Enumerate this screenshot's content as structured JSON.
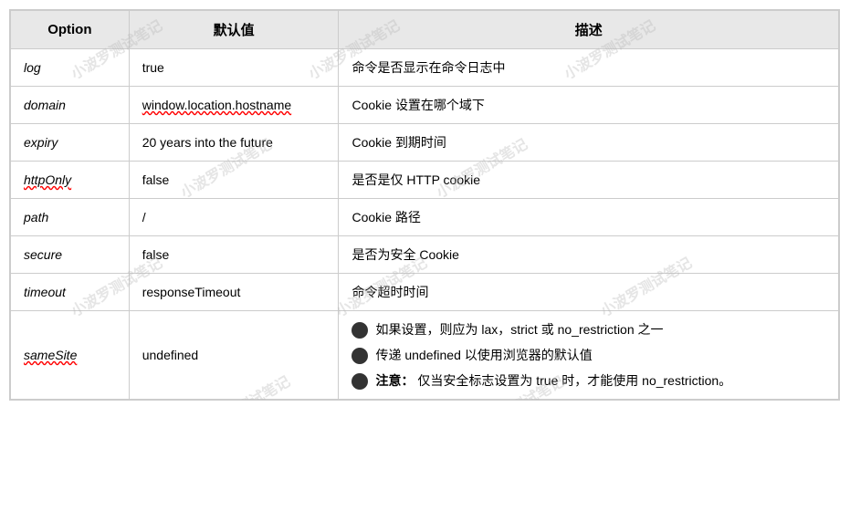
{
  "table": {
    "headers": {
      "option": "Option",
      "default": "默认值",
      "description": "描述"
    },
    "rows": [
      {
        "option": "log",
        "option_underline": false,
        "default": "true",
        "default_underline": false,
        "description_text": "命令是否显示在命令日志中",
        "description_type": "text"
      },
      {
        "option": "domain",
        "option_underline": false,
        "default": "window.location.hostname",
        "default_underline": true,
        "description_text": "Cookie 设置在哪个域下",
        "description_type": "text"
      },
      {
        "option": "expiry",
        "option_underline": false,
        "default": "20 years into the future",
        "default_underline": false,
        "description_text": "Cookie 到期时间",
        "description_type": "text"
      },
      {
        "option": "httpOnly",
        "option_underline": true,
        "default": "false",
        "default_underline": false,
        "description_text": "是否是仅 HTTP cookie",
        "description_type": "text"
      },
      {
        "option": "path",
        "option_underline": false,
        "default": "/",
        "default_underline": false,
        "description_text": "Cookie 路径",
        "description_type": "text"
      },
      {
        "option": "secure",
        "option_underline": false,
        "default": "false",
        "default_underline": false,
        "description_text": "是否为安全 Cookie",
        "description_type": "text"
      },
      {
        "option": "timeout",
        "option_underline": false,
        "default": "responseTimeout",
        "default_underline": false,
        "description_text": "命令超时时间",
        "description_type": "text"
      },
      {
        "option": "sameSite",
        "option_underline": true,
        "default": "undefined",
        "default_underline": false,
        "description_type": "list",
        "description_items": [
          {
            "text": "如果设置，则应为 lax，strict 或 no_restriction 之一",
            "bold_prefix": ""
          },
          {
            "text": "传递 undefined 以使用浏览器的默认值",
            "bold_prefix": ""
          },
          {
            "text": "仅当安全标志设置为 true 时，才能使用 no_restriction。",
            "bold_prefix": "注意："
          }
        ]
      }
    ]
  },
  "watermarks": [
    "小波罗测试笔记",
    "小波罗测试笔记",
    "小波罗测试笔记",
    "小波罗测试笔记",
    "小波罗测试笔记",
    "小波罗测试笔记"
  ]
}
